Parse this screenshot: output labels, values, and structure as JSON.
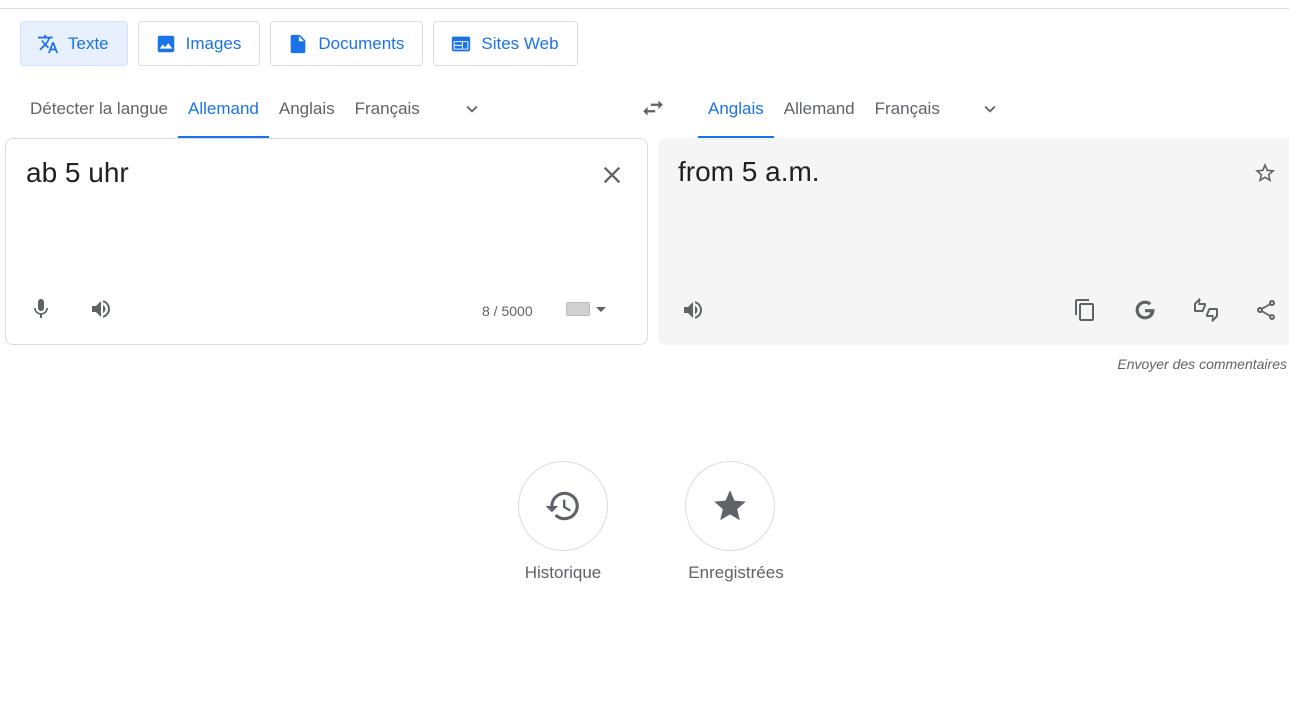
{
  "modes": [
    {
      "label": "Texte",
      "icon": "translate-icon",
      "active": true
    },
    {
      "label": "Images",
      "icon": "image-icon",
      "active": false
    },
    {
      "label": "Documents",
      "icon": "document-icon",
      "active": false
    },
    {
      "label": "Sites Web",
      "icon": "website-icon",
      "active": false
    }
  ],
  "source_langs": {
    "tabs": [
      "Détecter la langue",
      "Allemand",
      "Anglais",
      "Français"
    ],
    "active_index": 1
  },
  "target_langs": {
    "tabs": [
      "Anglais",
      "Allemand",
      "Français"
    ],
    "active_index": 0
  },
  "source": {
    "text": "ab 5 uhr",
    "counter": "8 / 5000"
  },
  "target": {
    "text": "from 5 a.m."
  },
  "feedback_label": "Envoyer des commentaires",
  "bottom": {
    "history_label": "Historique",
    "saved_label": "Enregistrées"
  },
  "colors": {
    "accent": "#1a73e8",
    "active_bg": "#e8f0fe",
    "target_panel_bg": "#f5f5f5",
    "icon": "#5f6368"
  }
}
